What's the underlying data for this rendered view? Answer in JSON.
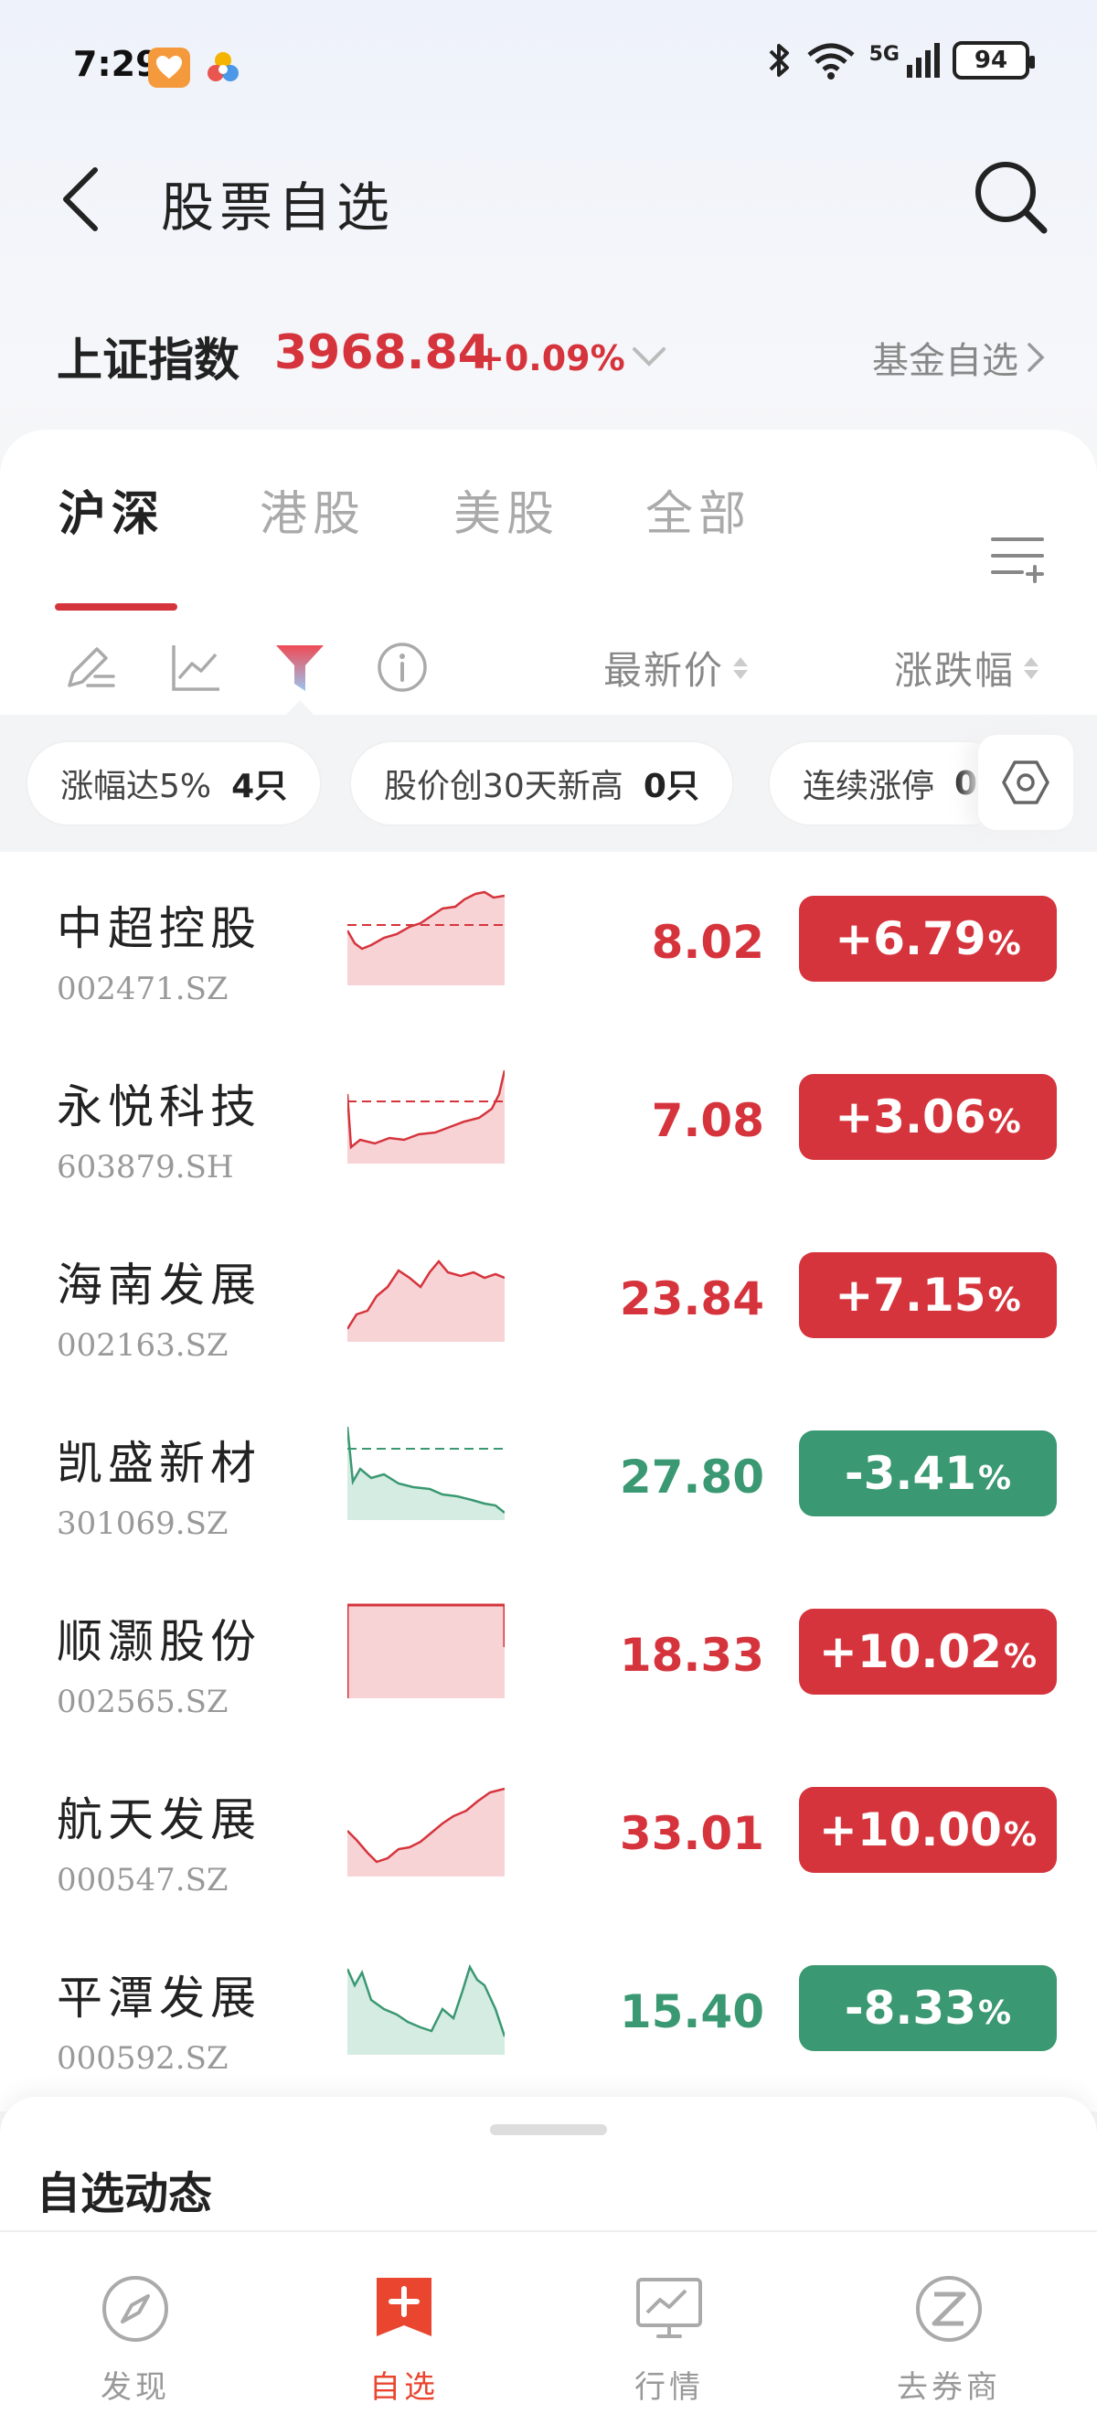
{
  "status_bar": {
    "time": "7:29",
    "battery": "94",
    "network": "5G"
  },
  "header": {
    "title": "股票自选"
  },
  "index_bar": {
    "name": "上证指数",
    "value": "3968.84",
    "change": "+0.09%",
    "fund_link": "基金自选"
  },
  "tabs": [
    {
      "label": "沪深",
      "active": true
    },
    {
      "label": "港股",
      "active": false
    },
    {
      "label": "美股",
      "active": false
    },
    {
      "label": "全部",
      "active": false
    }
  ],
  "columns": {
    "price": "最新价",
    "change": "涨跌幅"
  },
  "chips": [
    {
      "label": "涨幅达5%",
      "count": "4只"
    },
    {
      "label": "股价创30天新高",
      "count": "0只"
    },
    {
      "label": "连续涨停",
      "count": "0"
    }
  ],
  "stocks": [
    {
      "name": "中超控股",
      "code": "002471.SZ",
      "price": "8.02",
      "change": "+6.79",
      "trend": "up"
    },
    {
      "name": "永悦科技",
      "code": "603879.SH",
      "price": "7.08",
      "change": "+3.06",
      "trend": "up"
    },
    {
      "name": "海南发展",
      "code": "002163.SZ",
      "price": "23.84",
      "change": "+7.15",
      "trend": "up"
    },
    {
      "name": "凯盛新材",
      "code": "301069.SZ",
      "price": "27.80",
      "change": "-3.41",
      "trend": "down"
    },
    {
      "name": "顺灏股份",
      "code": "002565.SZ",
      "price": "18.33",
      "change": "+10.02",
      "trend": "up"
    },
    {
      "name": "航天发展",
      "code": "000547.SZ",
      "price": "33.01",
      "change": "+10.00",
      "trend": "up"
    },
    {
      "name": "平潭发展",
      "code": "000592.SZ",
      "price": "15.40",
      "change": "-8.33",
      "trend": "down"
    }
  ],
  "percent_sign": "%",
  "sheet": {
    "title": "自选动态"
  },
  "bottom_nav": [
    {
      "label": "发现",
      "icon": "compass-icon",
      "active": false
    },
    {
      "label": "自选",
      "icon": "add-watchlist-icon",
      "active": true
    },
    {
      "label": "行情",
      "icon": "market-chart-icon",
      "active": false
    },
    {
      "label": "去券商",
      "icon": "broker-icon",
      "active": false
    }
  ],
  "colors": {
    "up": "#d6343c",
    "down": "#3a9872",
    "accent": "#e9452f"
  }
}
